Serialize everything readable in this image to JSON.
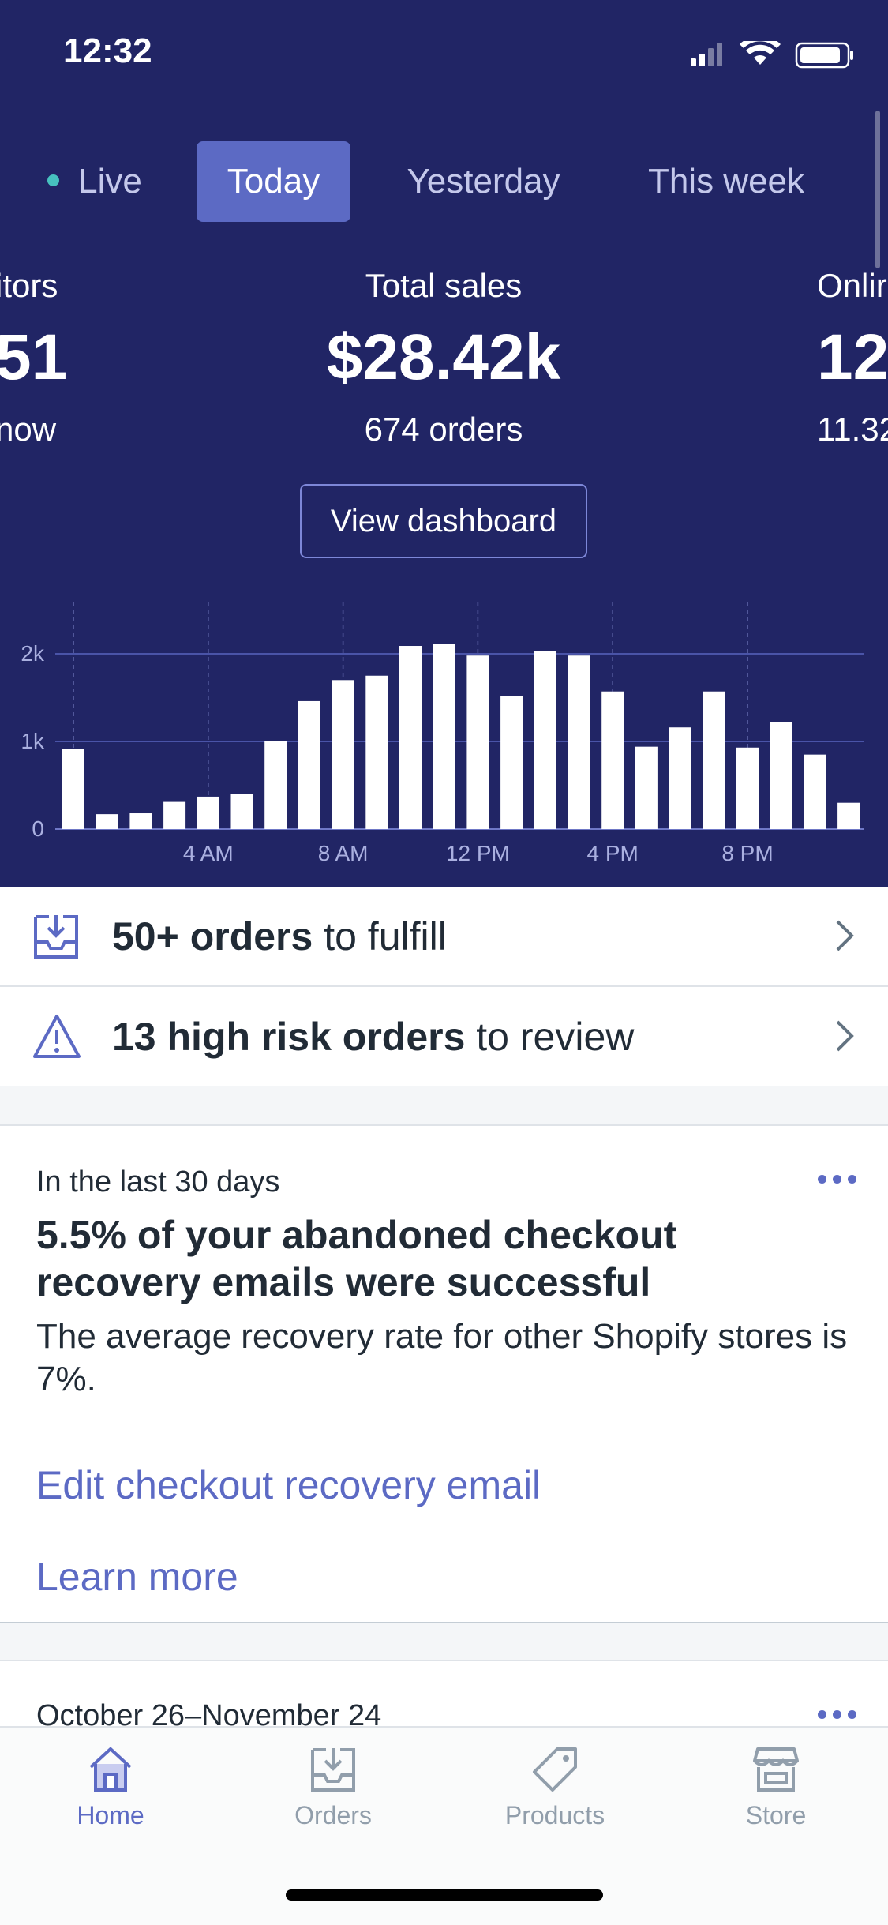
{
  "status_bar": {
    "time": "12:32"
  },
  "period_tabs": [
    {
      "label": "Live"
    },
    {
      "label": "Today",
      "active": true
    },
    {
      "label": "Yesterday"
    },
    {
      "label": "This week"
    }
  ],
  "metrics": {
    "left_partial": {
      "label": "itors",
      "value": "51",
      "sub": "now"
    },
    "center": {
      "label": "Total sales",
      "value": "$28.42k",
      "sub": "674 orders"
    },
    "right_partial": {
      "label": "Onlir",
      "value": "12",
      "sub": "11.32"
    }
  },
  "dashboard_button": "View dashboard",
  "chart_data": {
    "type": "bar",
    "categories": [
      "12 AM",
      "1 AM",
      "2 AM",
      "3 AM",
      "4 AM",
      "5 AM",
      "6 AM",
      "7 AM",
      "8 AM",
      "9 AM",
      "10 AM",
      "11 AM",
      "12 PM",
      "1 PM",
      "2 PM",
      "3 PM",
      "4 PM",
      "5 PM",
      "6 PM",
      "7 PM",
      "8 PM",
      "9 PM",
      "10 PM",
      "11 PM"
    ],
    "values": [
      910,
      170,
      180,
      310,
      370,
      400,
      1000,
      1460,
      1700,
      1750,
      2090,
      2110,
      1980,
      1520,
      2030,
      1980,
      1570,
      940,
      1160,
      1570,
      930,
      1220,
      850,
      300
    ],
    "x_tick_labels": [
      "4 AM",
      "8 AM",
      "12 PM",
      "4 PM",
      "8 PM"
    ],
    "y_tick_labels": [
      "0",
      "1k",
      "2k"
    ],
    "ylim": [
      0,
      2600
    ],
    "grid": true
  },
  "tasks": [
    {
      "bold": "50+ orders",
      "rest": " to fulfill",
      "icon": "inbox-download-icon"
    },
    {
      "bold": "13 high risk orders",
      "rest": " to review",
      "icon": "warning-triangle-icon"
    }
  ],
  "insight_card": {
    "eyebrow": "In the last 30 days",
    "title": "5.5% of your abandoned checkout recovery emails were successful",
    "body": "The average recovery rate for other Shopify stores is 7%.",
    "link_primary": "Edit checkout recovery email",
    "link_secondary": "Learn more"
  },
  "next_card": {
    "date_range": "October 26–November 24"
  },
  "tab_bar": [
    {
      "label": "Home",
      "icon": "home-icon",
      "active": true
    },
    {
      "label": "Orders",
      "icon": "orders-icon"
    },
    {
      "label": "Products",
      "icon": "tag-icon"
    },
    {
      "label": "Store",
      "icon": "store-icon"
    }
  ],
  "colors": {
    "hero_bg": "#212565",
    "accent": "#5c6ac4",
    "live": "#47c1bf"
  }
}
